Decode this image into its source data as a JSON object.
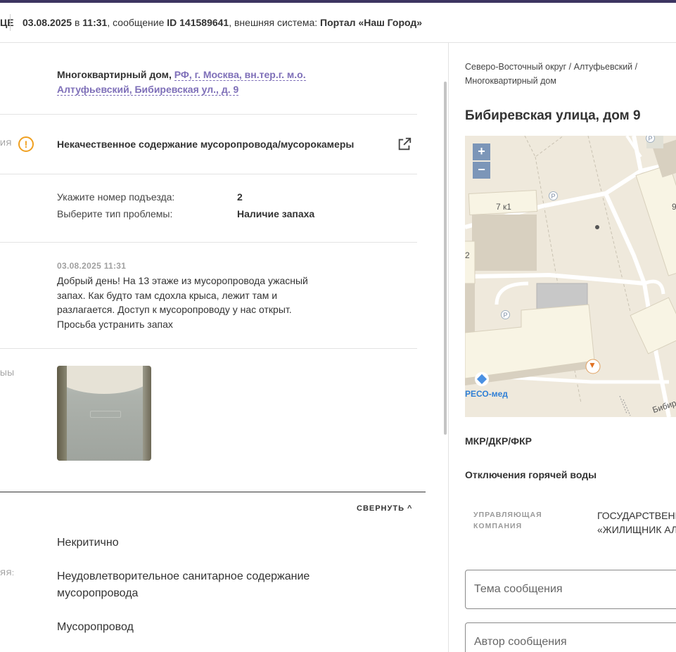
{
  "header": {
    "cut_word": "ЦЕ",
    "date": "03.08.2025",
    "at": " в ",
    "time": "11:31",
    "message_prefix": ", сообщение ",
    "message_id": "ID 141589641",
    "ext_prefix": ", внешняя система: ",
    "ext_system": "Портал «Наш Город»"
  },
  "details": {
    "address_prefix": "Многоквартирный дом, ",
    "address_link": "РФ, г. Москва, вн.тер.г. м.о. Алтуфьевский, Бибиревская ул., д. 9",
    "category_cut_label": "ИЯ",
    "category": "Некачественное содержание мусоропровода/мусорокамеры",
    "fields": [
      {
        "label": "Укажите номер подъезда:",
        "value": "2"
      },
      {
        "label": "Выберите тип проблемы:",
        "value": "Наличие запаха"
      }
    ],
    "message_date": "03.08.2025 11:31",
    "message_text": "Добрый день! На 13 этаже из мусоропровода ужасный запах. Как будто там сдохла крыса, лежит там и разлагается. Доступ к мусоропроводу у нас открыт. Просьба устранить запах",
    "photos_cut_label": "ЫЫ"
  },
  "classification": {
    "collapse_label": "СВЕРНУТЬ",
    "cut_label": "ЯЯ:",
    "criticality": "Некритично",
    "problem": "Неудовлетворительное санитарное содержание мусоропровода",
    "object": "Мусоропровод"
  },
  "side": {
    "breadcrumb": "Северо-Восточный округ / Алтуфьевский / Многоквартирный дом",
    "title": "Бибиревская улица, дом 9",
    "map": {
      "zoom_in": "+",
      "zoom_out": "−",
      "label_building_1": "7 к1",
      "label_building_2": "2",
      "label_building_3": "9",
      "label_parking": "P",
      "label_poi": "РЕСО-мед",
      "label_street": "Бибир"
    },
    "mkr": "МКР/ДКР/ФКР",
    "hot_water": "Отключения горячей воды",
    "uk_label": "УПРАВЛЯЮЩАЯ КОМПАНИЯ",
    "uk_value_line1": "ГОСУДАРСТВЕНН",
    "uk_value_line2": "«ЖИЛИЩНИК АЛТ",
    "subject_placeholder": "Тема сообщения",
    "author_placeholder": "Автор сообщения"
  },
  "colors": {
    "accent": "#3d3561",
    "link": "#7e6fb8",
    "warning": "#f0a020"
  }
}
